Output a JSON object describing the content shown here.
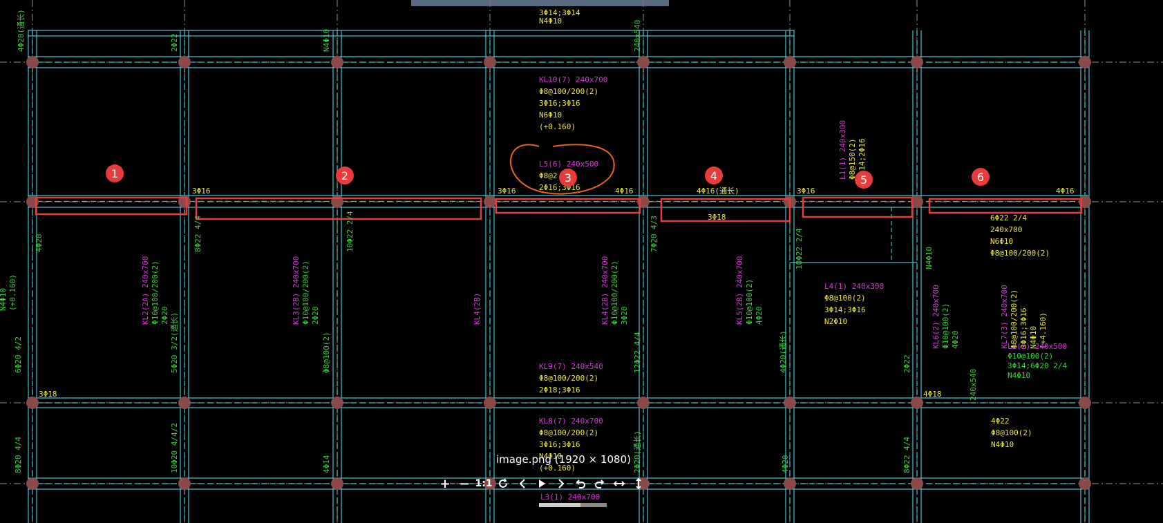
{
  "image_caption": "image.png (1920 × 1080)",
  "colors": {
    "background": "#000000",
    "beam_outline": "#44c0d0",
    "grid_node": "#8a4a4a",
    "rebar_text_green": "#3ad43a",
    "beam_name_magenta": "#d63ad6",
    "rebar_text_yellow": "#e8e840",
    "highlight_red": "#e83c3c",
    "annotation_orange": "#e8641e",
    "toolbar_icon": "#ffffff"
  },
  "markers": [
    "1",
    "2",
    "3",
    "4",
    "5",
    "6"
  ],
  "labels": {
    "kl10": [
      "KL10(7) 240x700",
      "Φ8@100/200(2)",
      "3Φ16;3Φ16",
      "N6Φ10",
      "(+0.160)"
    ],
    "l5": [
      "L5(6) 240x500",
      "Φ8@2",
      "2Φ16;3Φ16"
    ],
    "kl9": [
      "KL9(7) 240x540",
      "Φ8@100/200(2)",
      "2Φ18;3Φ16"
    ],
    "kl8": [
      "KL8(7) 240x700",
      "Φ8@100/200(2)",
      "3Φ16;3Φ16",
      "N4Φ10",
      "(+0.160)"
    ],
    "l3": [
      "L3(1) 240x700"
    ],
    "top_fragment": [
      "3Φ14;3Φ14",
      "N4Φ10"
    ],
    "l4": [
      "L4(1) 240x300",
      "Φ8@100(2)",
      "3Φ14;3Φ16",
      "N2Φ10"
    ],
    "l1_vert": [
      "L1(1) 240x300",
      "Φ8@150(2)",
      "3Φ14;2Φ16"
    ],
    "right_block": [
      "6Φ22 2/4",
      "240x700",
      "N6Φ10",
      "Φ8@100/200(2)"
    ],
    "right_block2": [
      "4Φ22",
      "Φ8@100(2)",
      "N4Φ10"
    ],
    "beam_top_marks": [
      "3Φ16",
      "3Φ16",
      "4Φ16",
      "4Φ16(通长)",
      "3Φ16",
      "4Φ16"
    ],
    "beam_mid_marks": [
      "3Φ18",
      "3Φ18",
      "4Φ18"
    ],
    "kl2": [
      "KL2(2A) 240x700",
      "Φ10@100/200(2)",
      "2Φ20"
    ],
    "kl3": [
      "KL3(2B) 240x700",
      "Φ10@100/200(2)",
      "2Φ20"
    ],
    "kl4": [
      "KL4(2B)"
    ],
    "kl4b": [
      "KL4(2B) 240x700",
      "Φ10@100/200(2)",
      "3Φ20"
    ],
    "kl5": [
      "KL5(2B) 240x700",
      "Φ10@100(2)",
      "4Φ20"
    ],
    "kl6": [
      "KL6(2) 240x700",
      "Φ10@100(2)",
      "4Φ20"
    ],
    "l2": [
      "L2(2) 240x500",
      "Φ10@100(2)",
      "3Φ14;6Φ20 2/4",
      "N4Φ10"
    ],
    "kl7": [
      "KL7(3) 240x700",
      "Φ8@100/200(2)",
      "3Φ16;3Φ16",
      "N4Φ10",
      "(+4.160)"
    ],
    "col_green": [
      "4Φ20(通长)",
      "2Φ22",
      "N4Φ10",
      "240x540",
      "4Φ20",
      "8Φ22 4/4",
      "10Φ22 2/4",
      "7Φ20 4/3",
      "6Φ20 4/2",
      "5Φ20 3/2(通长)",
      "Φ8@100(2)",
      "12Φ22 4/4",
      "8Φ20 4/4",
      "10Φ20 4/4/2",
      "4Φ14",
      "2Φ20(通长)"
    ],
    "left_edge": [
      "N4Φ10",
      "(+0.160)"
    ]
  },
  "toolbar": {
    "zoom_in": "+",
    "zoom_out": "−",
    "actual_size": "1:1",
    "refresh_icon": "refresh-icon",
    "prev_icon": "chevron-left-icon",
    "play_icon": "play-icon",
    "next_icon": "chevron-right-icon",
    "rotate_left_icon": "rotate-left-icon",
    "rotate_right_icon": "rotate-right-icon",
    "fit_width_icon": "fit-width-icon",
    "fit_height_icon": "fit-height-icon"
  }
}
